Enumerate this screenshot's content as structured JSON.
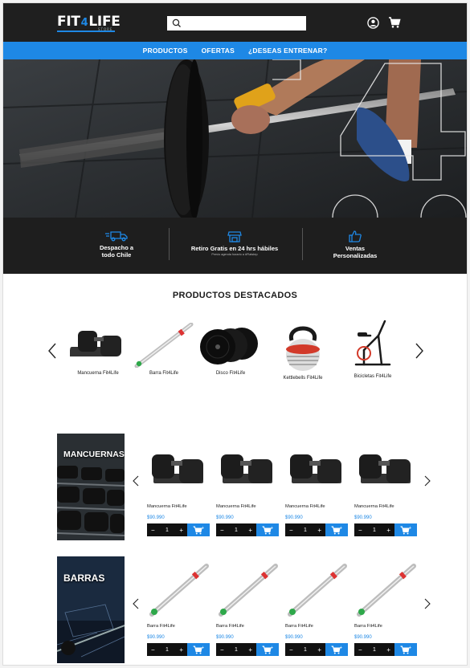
{
  "header": {
    "logo_left": "FIT",
    "logo_four": "4",
    "logo_right": "LIFE",
    "logo_sub": "STORE",
    "search_placeholder": ""
  },
  "nav": {
    "items": [
      "PRODUCTOS",
      "OFERTAS",
      "¿DESEAS ENTRENAR?"
    ]
  },
  "benefits": [
    {
      "line1": "Despacho a",
      "line2": "todo Chile",
      "note": ""
    },
    {
      "line1": "Retiro Gratis en 24 hrs hábiles",
      "line2": "",
      "note": "Previo agenda horario a #Flatstep"
    },
    {
      "line1": "Ventas",
      "line2": "Personalizadas",
      "note": ""
    }
  ],
  "featured": {
    "title": "PRODUCTOS DESTACADOS",
    "items": [
      "Mancuerna Fit4Life",
      "Barra Fit4Life",
      "Disco Fit4Life",
      "Kettlebells Fit4Life",
      "Bicicletas Fit4Life"
    ]
  },
  "categories": [
    {
      "name": "MANCUERNAS",
      "products": [
        {
          "name": "Mancuerna Fit4Life",
          "price": "$90.990",
          "qty": "1"
        },
        {
          "name": "Mancuerna Fit4Life",
          "price": "$90.990",
          "qty": "1"
        },
        {
          "name": "Mancuerna Fit4Life",
          "price": "$90.990",
          "qty": "1"
        },
        {
          "name": "Mancuerna Fit4Life",
          "price": "$90.990",
          "qty": "1"
        }
      ]
    },
    {
      "name": "BARRAS",
      "products": [
        {
          "name": "Barra Fit4Life",
          "price": "$90.990",
          "qty": "1"
        },
        {
          "name": "Barra Fit4Life",
          "price": "$90.990",
          "qty": "1"
        },
        {
          "name": "Barra Fit4Life",
          "price": "$90.990",
          "qty": "1"
        },
        {
          "name": "Barra Fit4Life",
          "price": "$90.990",
          "qty": "1"
        }
      ]
    }
  ],
  "qty_controls": {
    "minus": "−",
    "plus": "+"
  },
  "colors": {
    "accent": "#1e88e5",
    "dark": "#1f1f1f",
    "price": "#1e88e5"
  }
}
